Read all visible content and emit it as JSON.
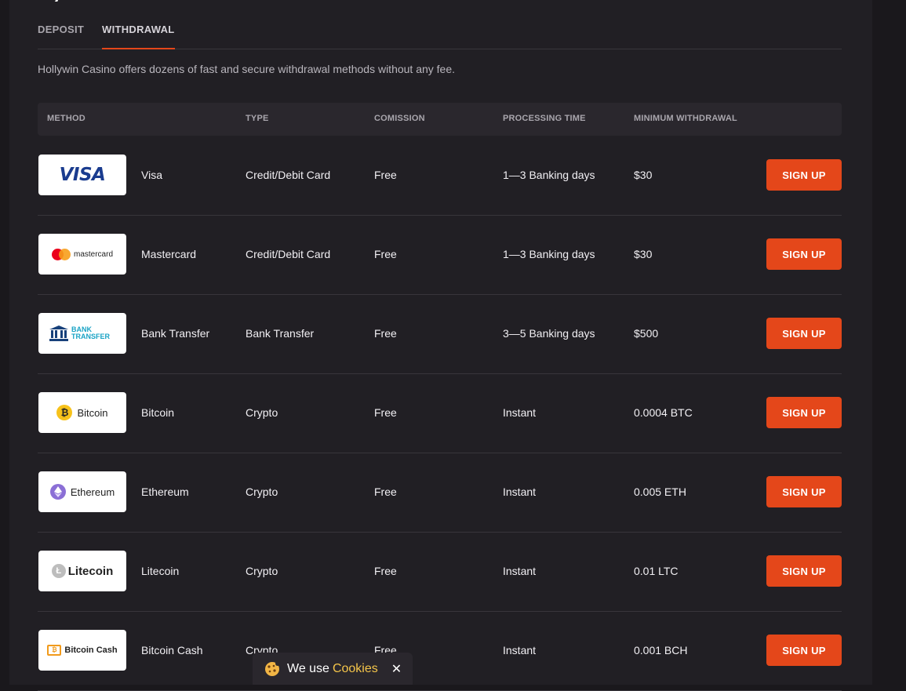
{
  "page": {
    "heading_fragment": "My"
  },
  "tabs": [
    {
      "label": "DEPOSIT",
      "active": false
    },
    {
      "label": "WITHDRAWAL",
      "active": true
    }
  ],
  "intro": "Hollywin Casino offers dozens of fast and secure withdrawal methods without any fee.",
  "table": {
    "headers": {
      "method": "METHOD",
      "type": "TYPE",
      "commission": "COMISSION",
      "processing_time": "PROCESSING TIME",
      "minimum_withdrawal": "MINIMUM WITHDRAWAL"
    },
    "rows": [
      {
        "logo": "visa-logo",
        "logo_text": "VISA",
        "method": "Visa",
        "type": "Credit/Debit Card",
        "commission": "Free",
        "processing_time": "1—3 Banking days",
        "minimum_withdrawal": "$30",
        "button": "SIGN UP"
      },
      {
        "logo": "mastercard-logo",
        "logo_text": "mastercard",
        "method": "Mastercard",
        "type": "Credit/Debit Card",
        "commission": "Free",
        "processing_time": "1—3 Banking days",
        "minimum_withdrawal": "$30",
        "button": "SIGN UP"
      },
      {
        "logo": "bank-transfer-logo",
        "logo_text": "BANK TRANSFER",
        "method": "Bank Transfer",
        "type": "Bank Transfer",
        "commission": "Free",
        "processing_time": "3—5 Banking days",
        "minimum_withdrawal": "$500",
        "button": "SIGN UP"
      },
      {
        "logo": "bitcoin-logo",
        "logo_text": "Bitcoin",
        "method": "Bitcoin",
        "type": "Crypto",
        "commission": "Free",
        "processing_time": "Instant",
        "minimum_withdrawal": "0.0004 BTC",
        "button": "SIGN UP"
      },
      {
        "logo": "ethereum-logo",
        "logo_text": "Ethereum",
        "method": "Ethereum",
        "type": "Crypto",
        "commission": "Free",
        "processing_time": "Instant",
        "minimum_withdrawal": "0.005 ETH",
        "button": "SIGN UP"
      },
      {
        "logo": "litecoin-logo",
        "logo_text": "Litecoin",
        "method": "Litecoin",
        "type": "Crypto",
        "commission": "Free",
        "processing_time": "Instant",
        "minimum_withdrawal": "0.01 LTC",
        "button": "SIGN UP"
      },
      {
        "logo": "bitcoin-cash-logo",
        "logo_text": "Bitcoin Cash",
        "method": "Bitcoin Cash",
        "type": "Crypto",
        "commission": "Free",
        "processing_time": "Instant",
        "minimum_withdrawal": "0.001 BCH",
        "button": "SIGN UP"
      }
    ]
  },
  "cookie_banner": {
    "text": "We use",
    "link": "Cookies",
    "close": "✕",
    "icon": "cookie-icon"
  },
  "colors": {
    "accent": "#e4471a",
    "background": "#1a181c",
    "panel": "#211f24",
    "cookie_link": "#f4c54a"
  }
}
